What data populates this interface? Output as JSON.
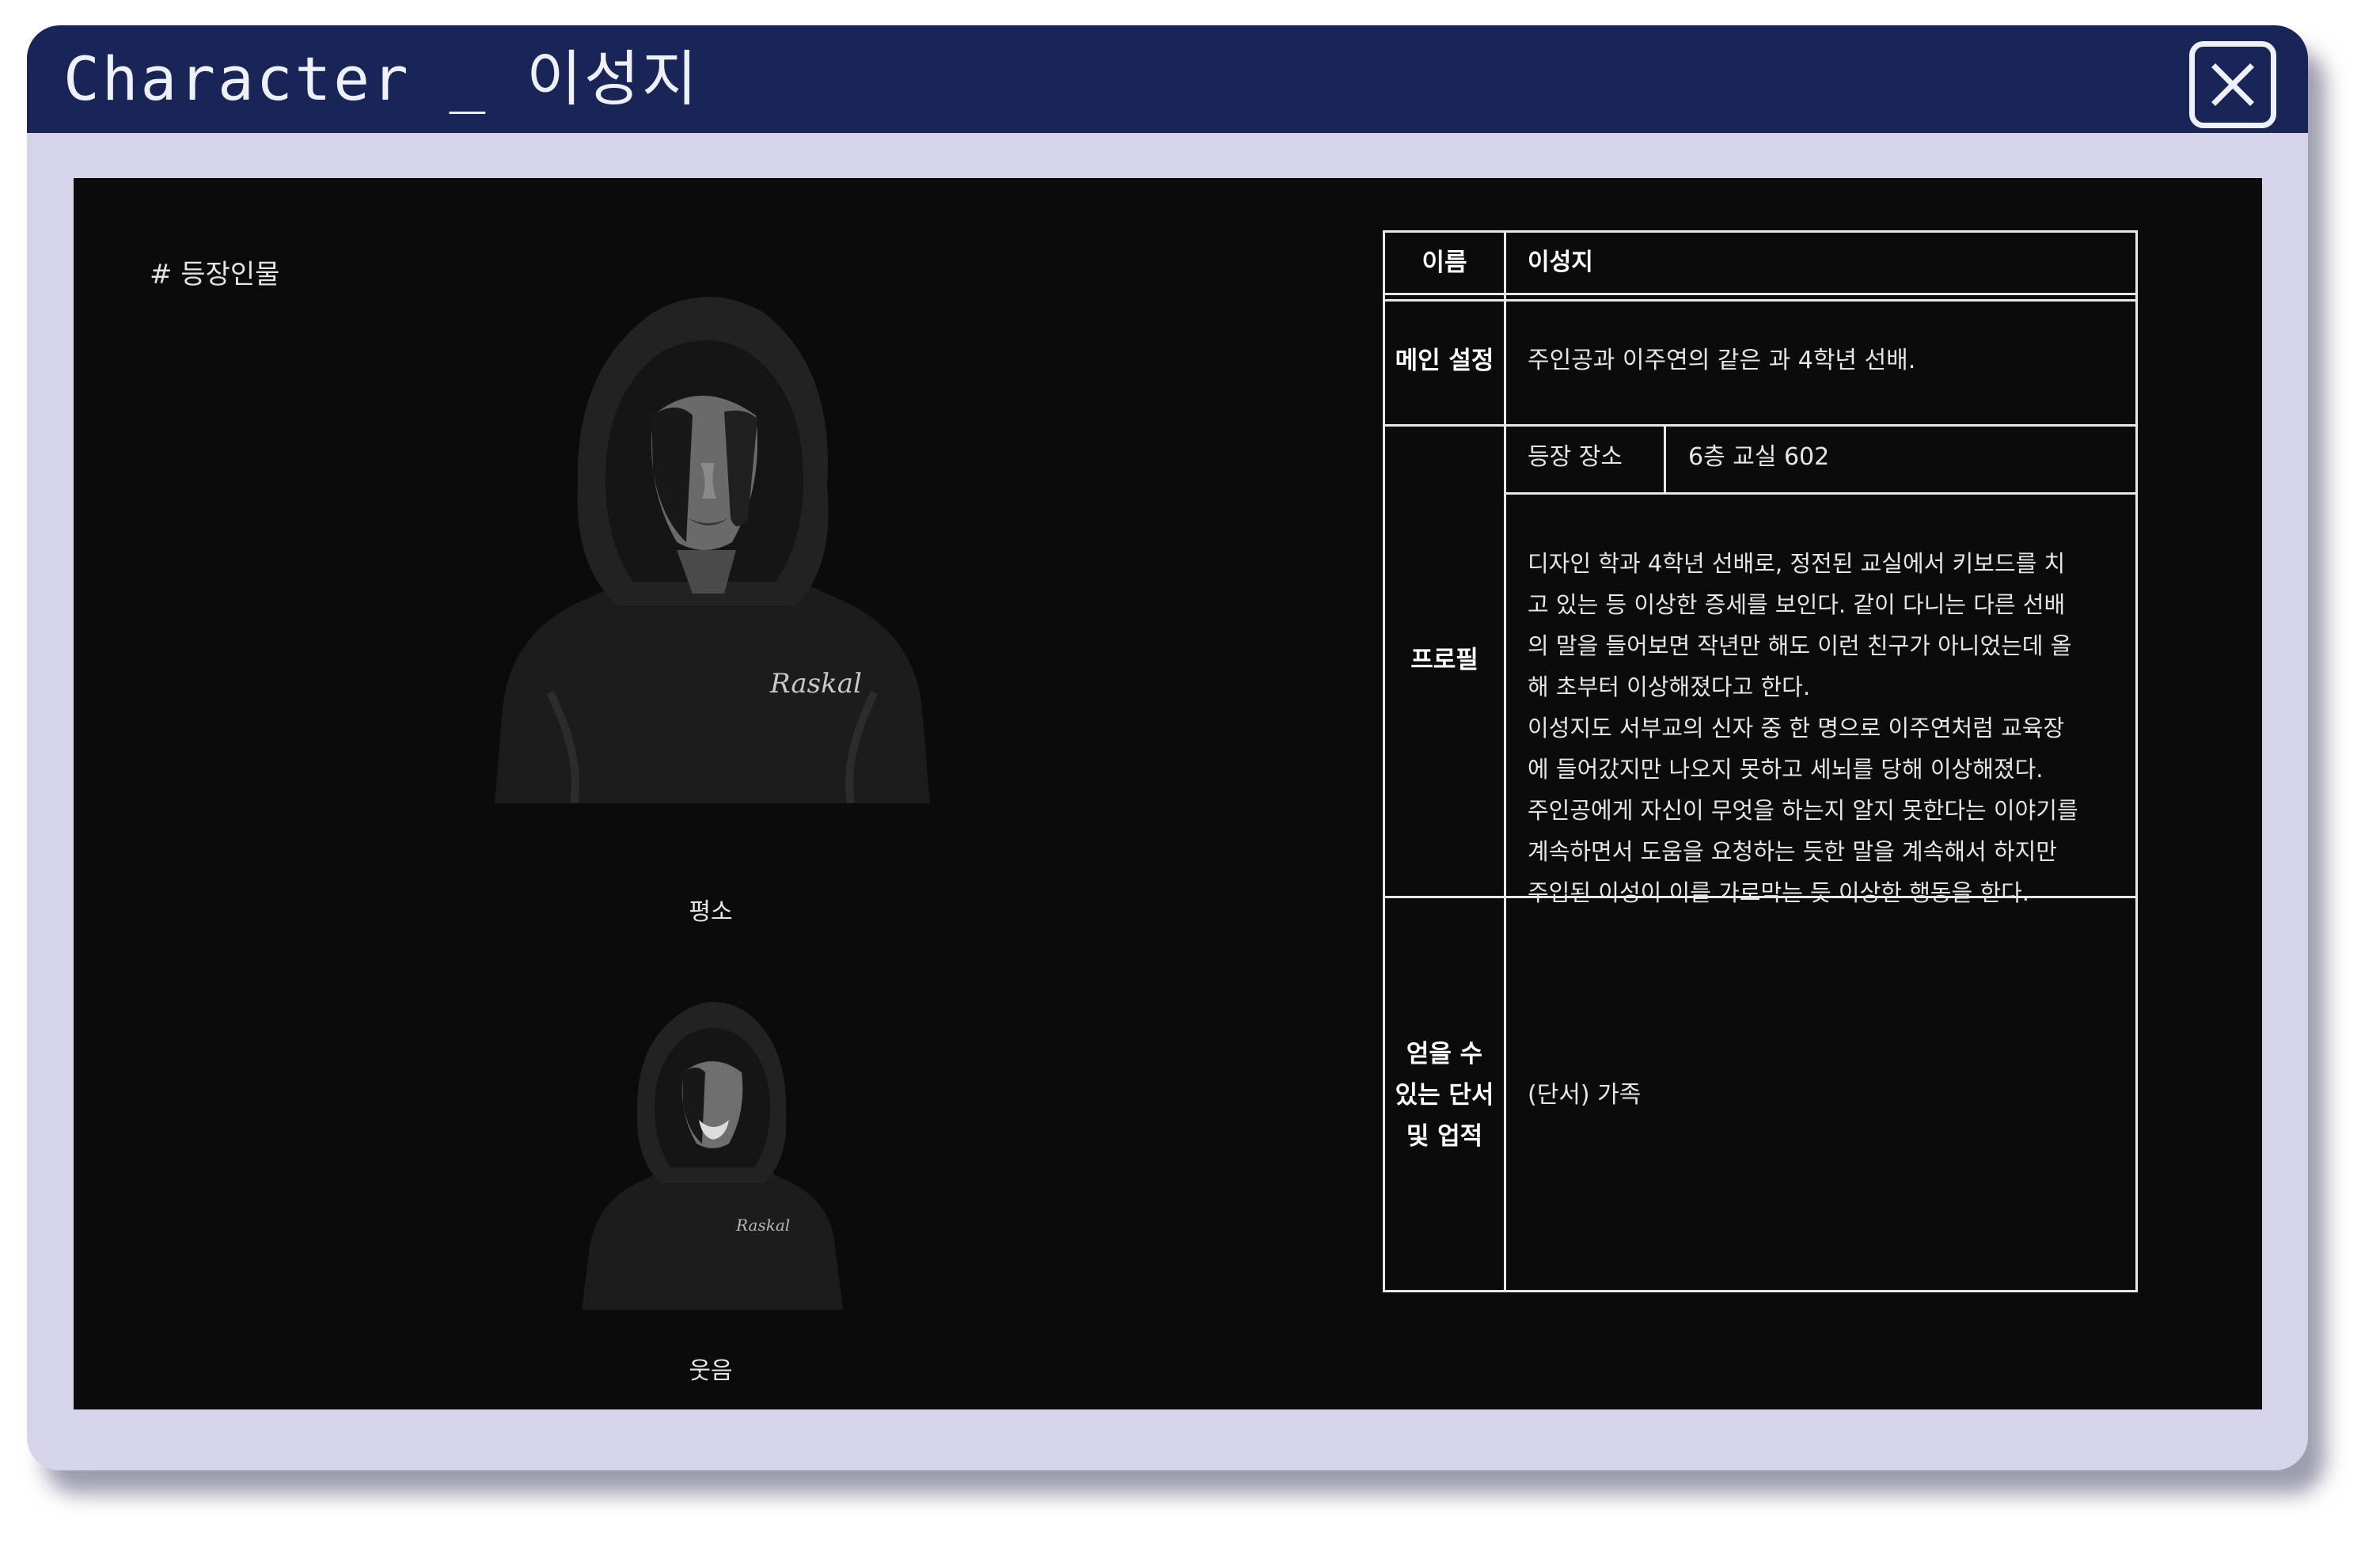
{
  "window": {
    "title": "Character _ 이성지",
    "close_icon": "close-x-icon"
  },
  "content": {
    "section_tag": "# 등장인물",
    "portraits": [
      {
        "caption": "평소",
        "shirt_text": "Raskal"
      },
      {
        "caption": "웃음",
        "shirt_text": "Raskal"
      }
    ],
    "table": {
      "name_label": "이름",
      "name_value": "이성지",
      "setting_label": "메인 설정",
      "setting_value": "주인공과 이주연의 같은 과 4학년 선배.",
      "profile_label": "프로필",
      "location_label": "등장 장소",
      "location_value": "6층 교실 602",
      "profile_lines": [
        "디자인 학과 4학년 선배로, 정전된 교실에서 키보드를 치",
        "고 있는 등 이상한 증세를 보인다. 같이 다니는 다른 선배",
        "의 말을 들어보면 작년만 해도 이런 친구가 아니었는데 올",
        "해 초부터 이상해졌다고 한다.",
        "이성지도 서부교의 신자 중 한 명으로 이주연처럼 교육장",
        "에 들어갔지만 나오지 못하고 세뇌를 당해 이상해졌다.",
        "주인공에게 자신이 무엇을 하는지 알지 못한다는 이야기를",
        "계속하면서 도움을 요청하는 듯한 말을 계속해서 하지만",
        "주입된 이성이 이를 가로막는 듯 이상한 행동을 한다."
      ],
      "clue_label_lines": [
        "얻을 수",
        "있는 단서",
        "및 업적"
      ],
      "clue_value": "(단서) 가족"
    }
  },
  "colors": {
    "title_bar": "#1a2557",
    "window_frame": "#d6d4eb",
    "content_bg": "#0b0b0b",
    "text": "#e6e6e6"
  }
}
